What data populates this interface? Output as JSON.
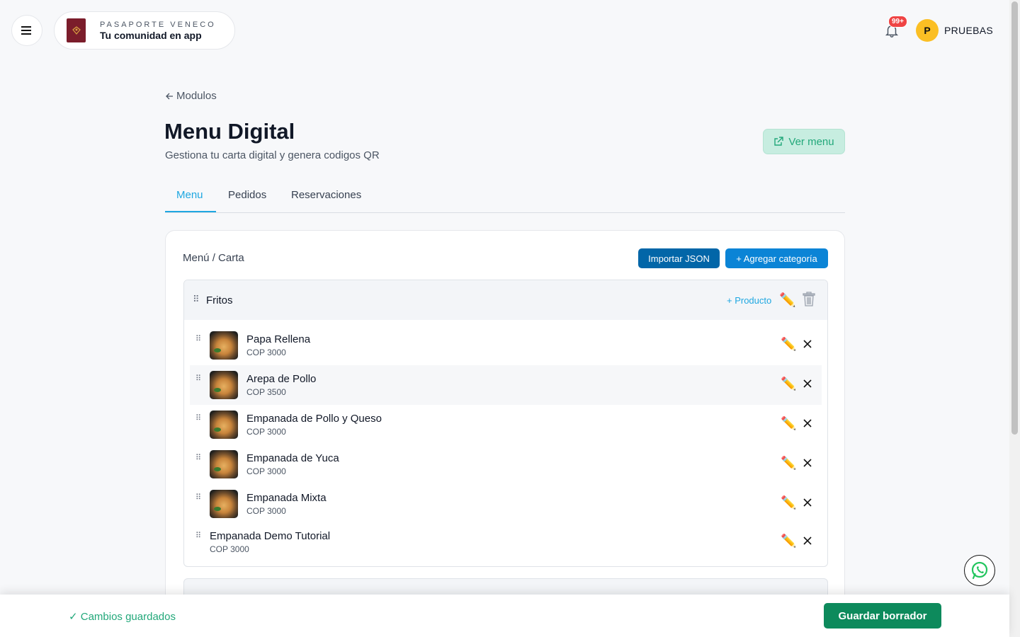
{
  "brand": {
    "title": "PASAPORTE VENECO",
    "subtitle": "Tu comunidad en app"
  },
  "notifications": {
    "badge": "99+"
  },
  "user": {
    "initial": "P",
    "name": "PRUEBAS"
  },
  "header": {
    "back_label": "Modulos",
    "title": "Menu Digital",
    "subtitle": "Gestiona tu carta digital y genera codigos QR",
    "view_menu_label": "Ver menu"
  },
  "tabs": [
    {
      "label": "Menu",
      "active": true
    },
    {
      "label": "Pedidos",
      "active": false
    },
    {
      "label": "Reservaciones",
      "active": false
    }
  ],
  "card": {
    "title": "Menú / Carta",
    "import_label": "Importar JSON",
    "add_category_label": "+ Agregar categoría"
  },
  "category": {
    "name": "Fritos",
    "add_product_label": "+ Producto",
    "items": [
      {
        "name": "Papa Rellena",
        "price": "COP 3000"
      },
      {
        "name": "Arepa de Pollo",
        "price": "COP 3500"
      },
      {
        "name": "Empanada de Pollo y Queso",
        "price": "COP 3000"
      },
      {
        "name": "Empanada de Yuca",
        "price": "COP 3000"
      },
      {
        "name": "Empanada Mixta",
        "price": "COP 3000"
      },
      {
        "name": "Empanada Demo Tutorial",
        "price": "COP 3000"
      }
    ]
  },
  "footer": {
    "status": "✓ Cambios guardados",
    "save_label": "Guardar borrador"
  },
  "colors": {
    "accent": "#1ea7e1",
    "primary": "#0266a8",
    "success": "#0d8a5c",
    "danger": "#ef4444"
  }
}
